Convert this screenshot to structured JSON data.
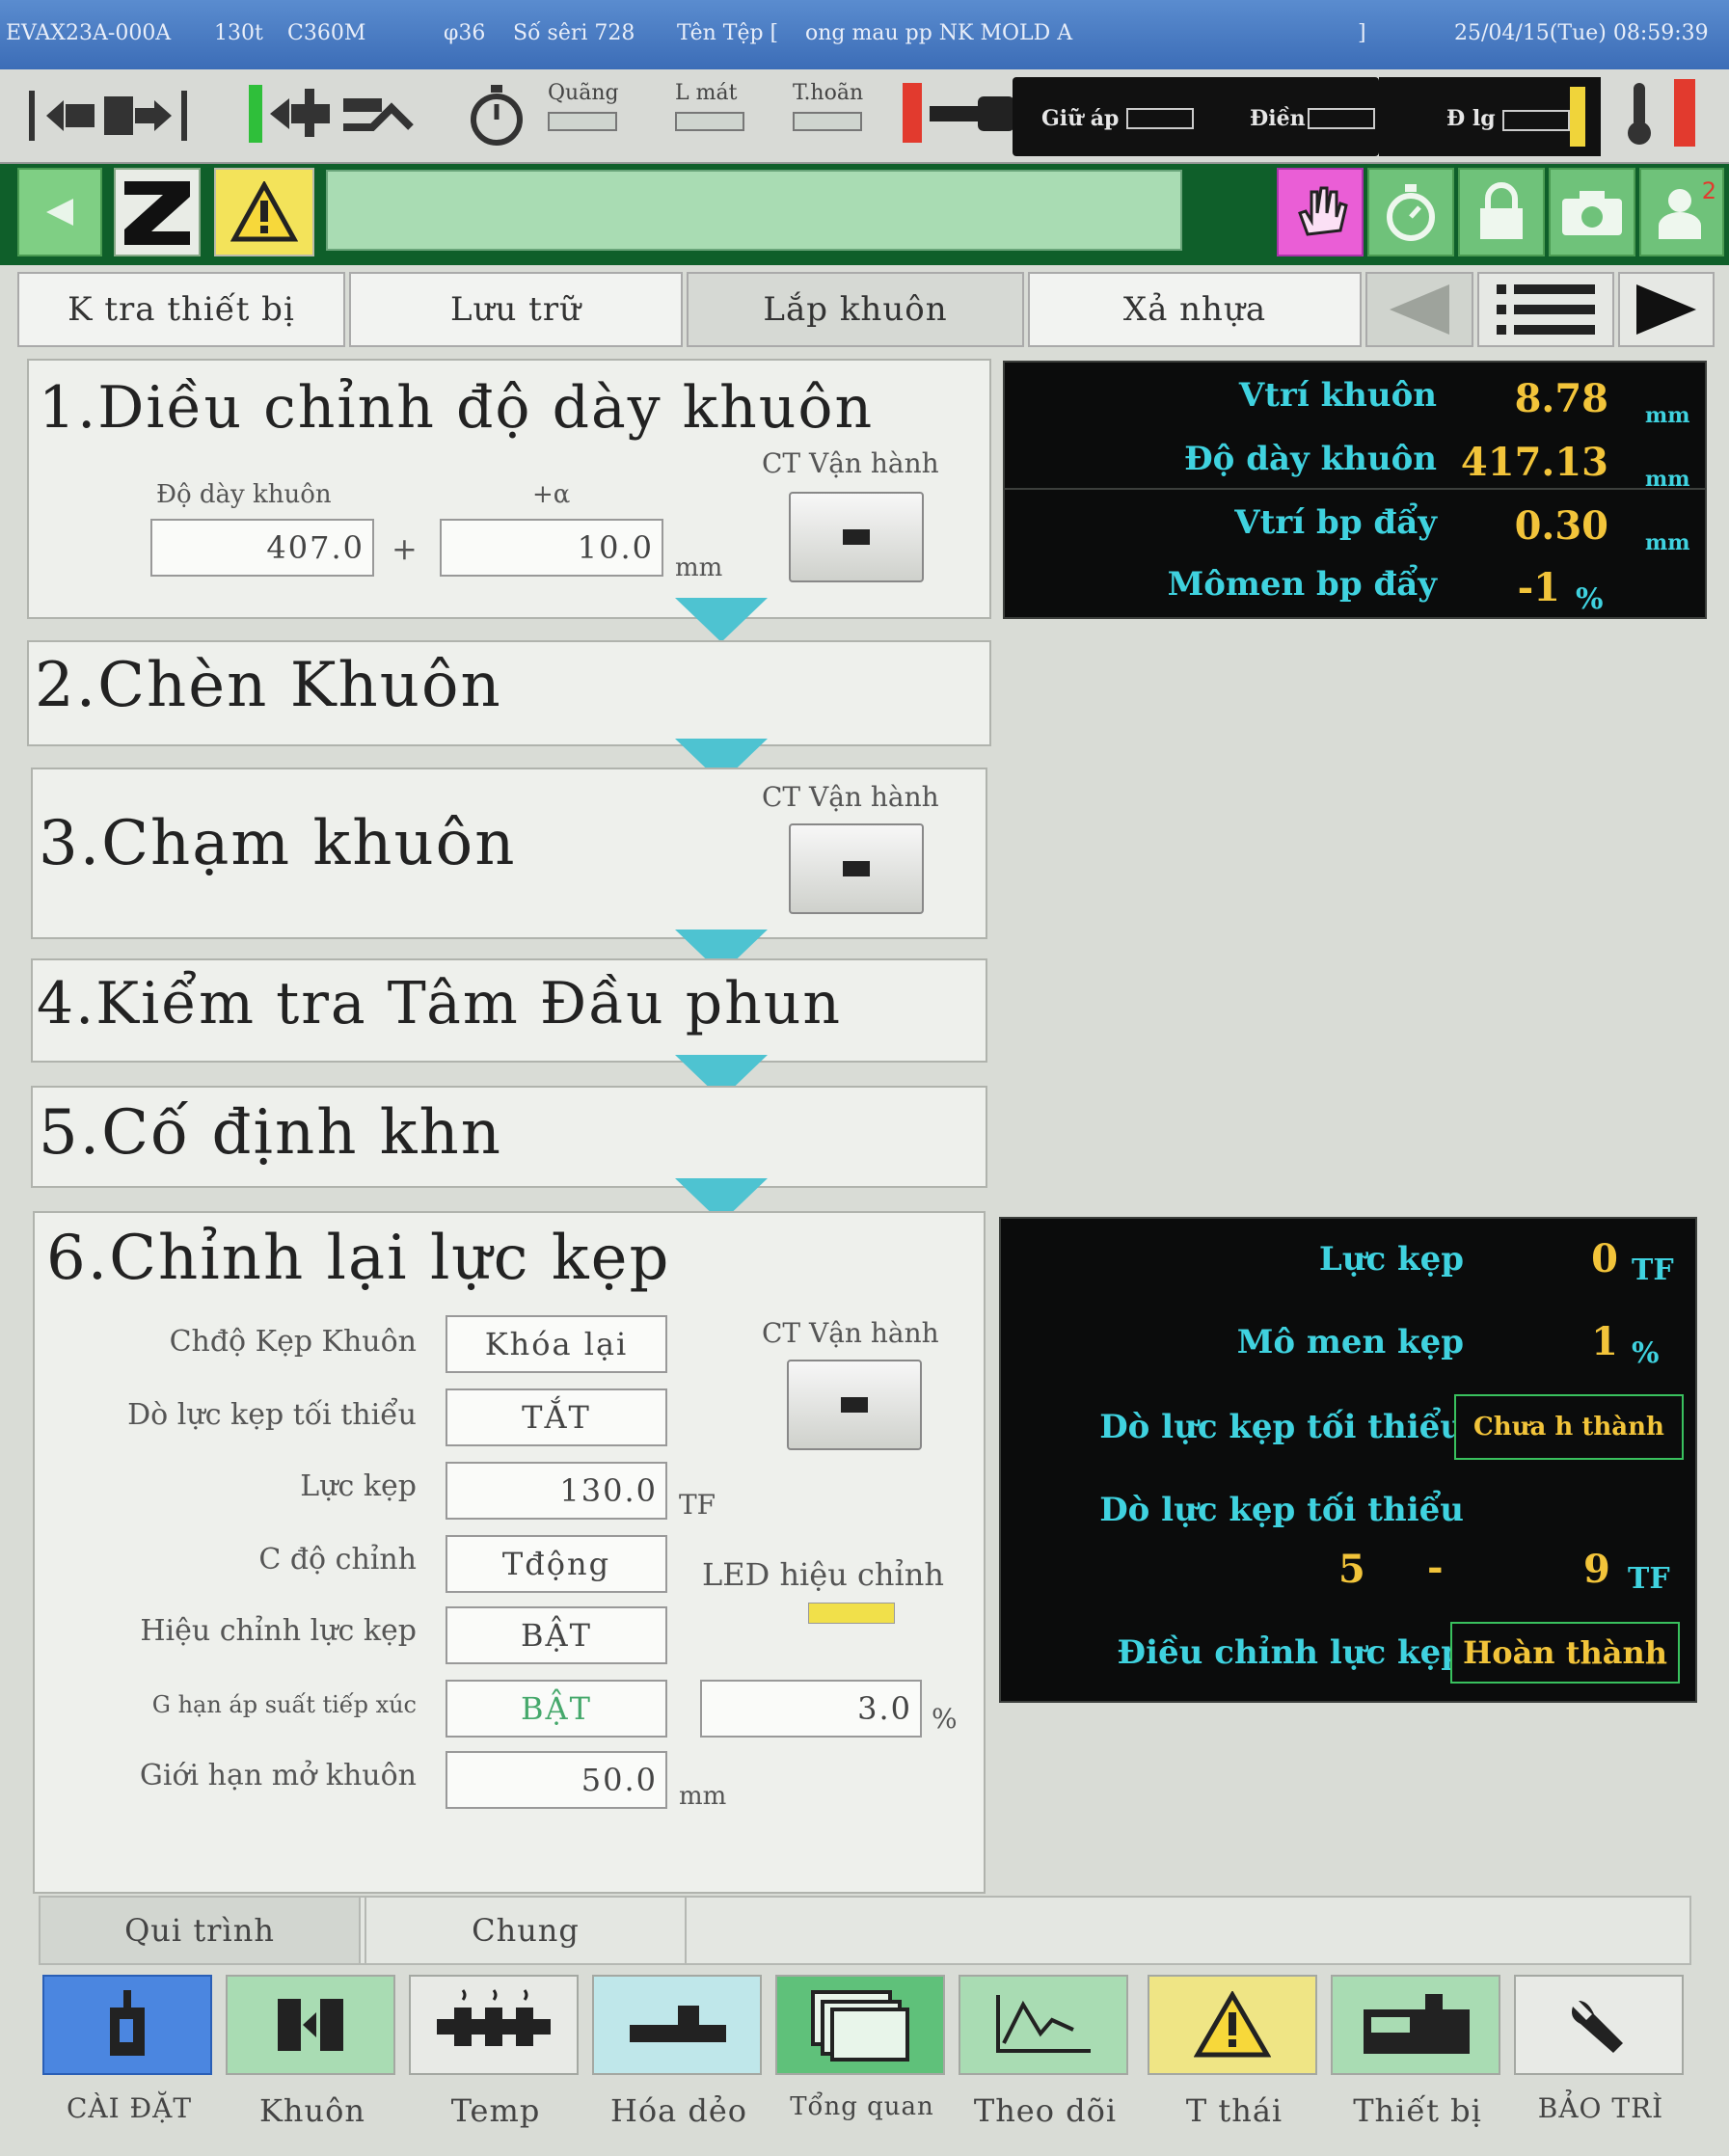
{
  "titlebar": {
    "machine": "EVAX23A-000A",
    "tonnage": "130t",
    "model": "C360M",
    "screw": "φ36",
    "serial": "Số sêri 728",
    "file_label": "Tên Tệp [",
    "file_name": "ong mau pp NK MOLD A",
    "file_end": "]",
    "datetime": "25/04/15(Tue) 08:59:39"
  },
  "statusbar": {
    "quang": "Quãng",
    "lmat": "L mát",
    "thoan": "T.hoãn",
    "giu_ap": "Giữ áp",
    "dien": "Điền",
    "dlg": "Đ lg"
  },
  "colors": {
    "accent_cyan": "#3fd2df",
    "value_yellow": "#f2c43a",
    "toolbar_green": "#0f5f2a",
    "arrow": "#4ec3d1"
  },
  "tabs": [
    {
      "label": "K tra thiết bị"
    },
    {
      "label": "Lưu trữ"
    },
    {
      "label": "Lắp khuôn"
    },
    {
      "label": "Xả nhựa"
    }
  ],
  "step1": {
    "title": "1.Diều chỉnh độ dày khuôn",
    "run_label": "CT Vận hành",
    "thickness_label": "Độ dày khuôn",
    "alpha_label": "+α",
    "thickness_value": "407.0",
    "plus": "+",
    "alpha_value": "10.0",
    "unit": "mm"
  },
  "step2": {
    "title": "2.Chèn Khuôn"
  },
  "step3": {
    "title": "3.Chạm khuôn",
    "run_label": "CT Vận hành"
  },
  "step4": {
    "title": "4.Kiểm tra Tâm Đầu phun"
  },
  "step5": {
    "title": "5.Cố định khn"
  },
  "step6": {
    "title": "6.Chỉnh lại lực kẹp",
    "run_label": "CT Vận hành",
    "rows": [
      {
        "label": "Chđộ Kẹp Khuôn",
        "value": "Khóa lại"
      },
      {
        "label": "Dò lực kẹp tối thiểu",
        "value": "TẮT"
      },
      {
        "label": "Lực kẹp",
        "value": "130.0",
        "unit": "TF"
      },
      {
        "label": "C độ chỉnh",
        "value": "Tđộng"
      },
      {
        "label": "Hiệu chỉnh lực kẹp",
        "value": "BẬT"
      },
      {
        "label": "G hạn áp suất tiếp xúc",
        "value": "BẬT",
        "extra_value": "3.0",
        "extra_unit": "%"
      },
      {
        "label": "Giới hạn mở khuôn",
        "value": "50.0",
        "unit": "mm"
      }
    ],
    "led_label": "LED hiệu chỉnh"
  },
  "monitor_top": [
    {
      "label": "Vtrí khuôn",
      "value": "8.78",
      "unit": "mm"
    },
    {
      "label": "Độ dày khuôn",
      "value": "417.13",
      "unit": "mm"
    },
    {
      "label": "Vtrí bp đẩy",
      "value": "0.30",
      "unit": "mm"
    },
    {
      "label": "Mômen bp đẩy",
      "value": "-1",
      "unit": "%"
    }
  ],
  "monitor_bottom": {
    "clamp_force_label": "Lực kẹp",
    "clamp_force_value": "0",
    "clamp_force_unit": "TF",
    "torque_label": "Mô men kẹp",
    "torque_value": "1",
    "torque_unit": "%",
    "min_search_label": "Dò lực kẹp tối thiểu",
    "min_search_status": "Chưa h thành",
    "min_range_label": "Dò lực kẹp tối thiểu",
    "min_range_from": "5",
    "min_range_dash": "-",
    "min_range_to": "9",
    "min_range_unit": "TF",
    "adjust_label": "Điều chỉnh lực kẹp",
    "adjust_status": "Hoàn thành"
  },
  "subtabs": [
    {
      "label": "Qui trình"
    },
    {
      "label": "Chung"
    }
  ],
  "bottom_nav": [
    {
      "label": "CÀI ĐẶT",
      "icon": "settings-icon"
    },
    {
      "label": "Khuôn",
      "icon": "mold-icon"
    },
    {
      "label": "Temp",
      "icon": "heater-icon"
    },
    {
      "label": "Hóa dẻo",
      "icon": "plasticize-icon"
    },
    {
      "label": "Tổng quan",
      "icon": "overview-icon"
    },
    {
      "label": "Theo dõi",
      "icon": "monitor-icon"
    },
    {
      "label": "T thái",
      "icon": "warning-icon"
    },
    {
      "label": "Thiết bị",
      "icon": "device-icon"
    },
    {
      "label": "BẢO TRÌ",
      "icon": "wrench-icon"
    }
  ],
  "toolbar": {
    "user_badge": "2"
  }
}
